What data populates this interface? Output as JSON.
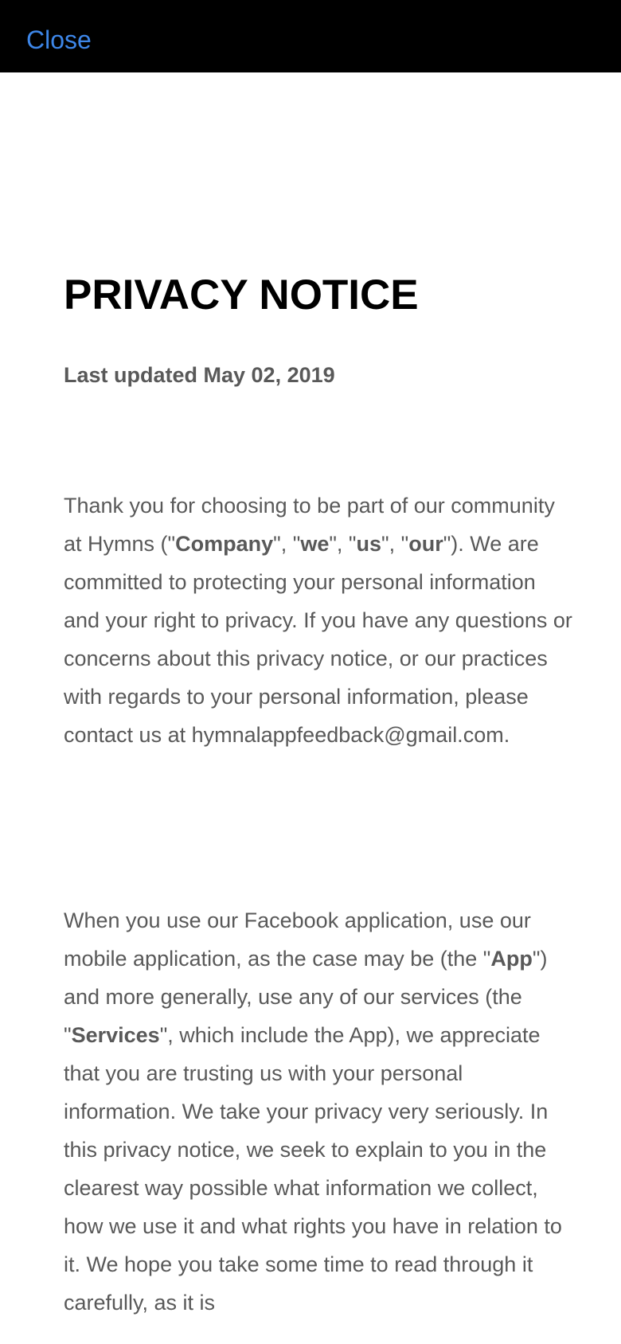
{
  "nav": {
    "close_label": "Close"
  },
  "document": {
    "title": "PRIVACY NOTICE",
    "last_updated": "Last updated May 02, 2019",
    "para1": {
      "s1": "Thank you for choosing to be part of our community at Hymns (\"",
      "b1": "Company",
      "s2": "\", \"",
      "b2": "we",
      "s3": "\", \"",
      "b3": "us",
      "s4": "\", \"",
      "b4": "our",
      "s5": "\"). We are committed to protecting your personal information and your right to privacy. If you have any questions or concerns about this privacy notice, or our practices with regards to your personal information, please contact us at hymnalappfeedback@gmail.com."
    },
    "para2": {
      "s1": "When you use our Facebook application, use our mobile application, as the case may be (the \"",
      "b1": "App",
      "s2": "\") and more generally, use any of our services (the \"",
      "b2": "Services",
      "s3": "\", which include the App), we appreciate that you are trusting us with your personal information. We take your privacy very seriously. In this privacy notice, we seek to explain to you in the clearest way possible what information we collect, how we use it and what rights you have in relation to it. We hope you take some time to read through it carefully, as it is"
    }
  },
  "colors": {
    "topbar": "#000000",
    "link": "#3d86e8",
    "heading": "#000000",
    "body_text": "#595959",
    "background": "#ffffff"
  }
}
